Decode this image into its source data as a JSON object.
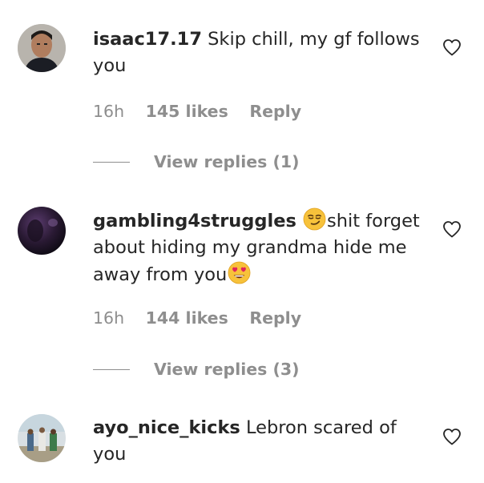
{
  "comments": [
    {
      "username": "isaac17.17",
      "text_before_emoji": "Skip chill, my gf follows you",
      "time": "16h",
      "likes": "145 likes",
      "reply_label": "Reply",
      "view_replies": "View replies (1)",
      "avatar_icon": "profile-photo-man"
    },
    {
      "username": "gambling4struggles",
      "emoji_1": "smirking-face-emoji",
      "text_middle": "shit forget about hiding my grandma hide me away from you",
      "emoji_2": "heart-eyes-emoji",
      "time": "16h",
      "likes": "144 likes",
      "reply_label": "Reply",
      "view_replies": "View replies (3)",
      "avatar_icon": "profile-photo-dark"
    },
    {
      "username": "ayo_nice_kicks",
      "text_before_emoji": "Lebron scared of you",
      "avatar_icon": "profile-photo-group"
    }
  ],
  "colors": {
    "primary_text": "#262626",
    "secondary_text": "#8e8e8e",
    "heart_stroke": "#262626",
    "emoji_yellow": "#f7c23b",
    "heart_eyes_red": "#e0245e"
  },
  "icons": {
    "like": "heart-outline-icon"
  }
}
